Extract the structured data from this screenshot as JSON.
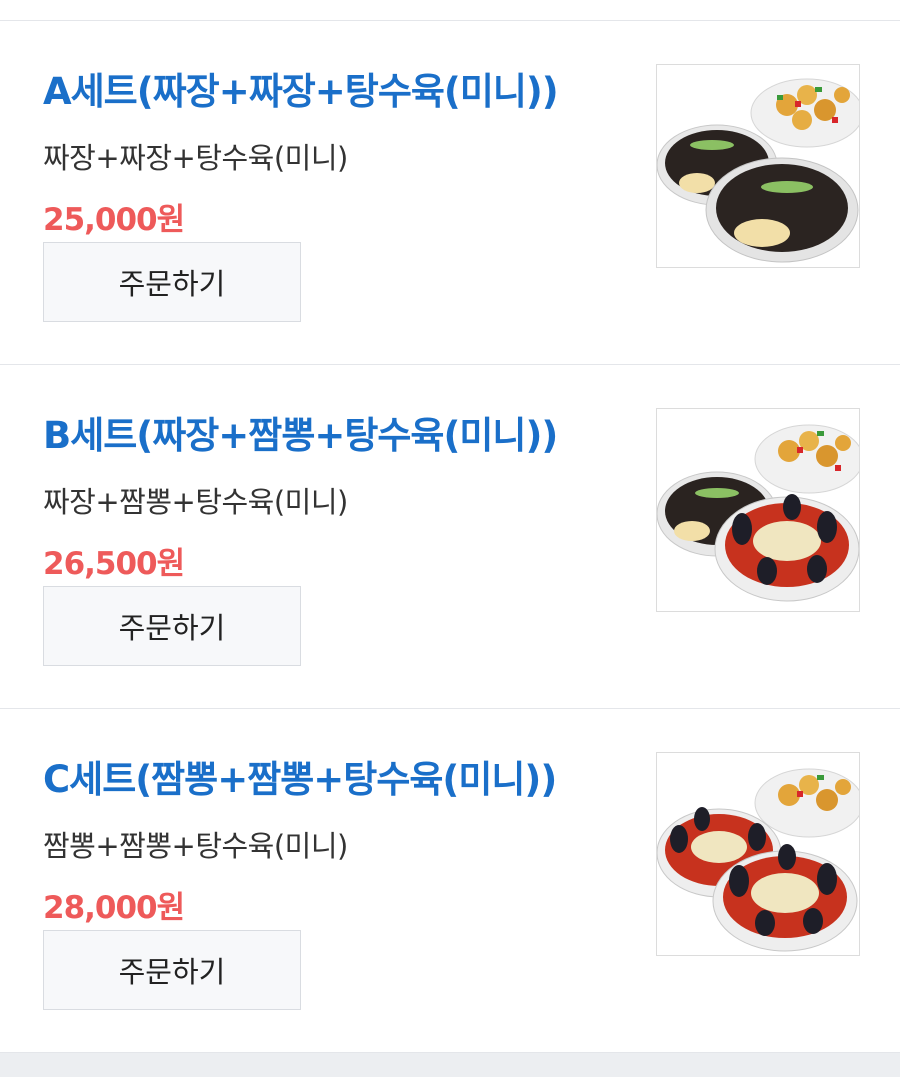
{
  "menu": {
    "items": [
      {
        "title": "A세트(짜장+짜장+탕수육(미니))",
        "description": "짜장+짜장+탕수육(미니)",
        "price": "25,000원",
        "order_label": "주문하기",
        "image_icon": "food-photo-jjajang-jjajang-tangsuyuk"
      },
      {
        "title": "B세트(짜장+짬뽕+탕수육(미니))",
        "description": "짜장+짬뽕+탕수육(미니)",
        "price": "26,500원",
        "order_label": "주문하기",
        "image_icon": "food-photo-jjajang-jjamppong-tangsuyuk"
      },
      {
        "title": "C세트(짬뽕+짬뽕+탕수육(미니))",
        "description": "짬뽕+짬뽕+탕수육(미니)",
        "price": "28,000원",
        "order_label": "주문하기",
        "image_icon": "food-photo-jjamppong-jjamppong-tangsuyuk"
      }
    ]
  },
  "colors": {
    "title": "#1a6fc9",
    "price": "#ee5a5a",
    "button_bg": "#f7f8fa",
    "divider": "#e4e6ea"
  }
}
